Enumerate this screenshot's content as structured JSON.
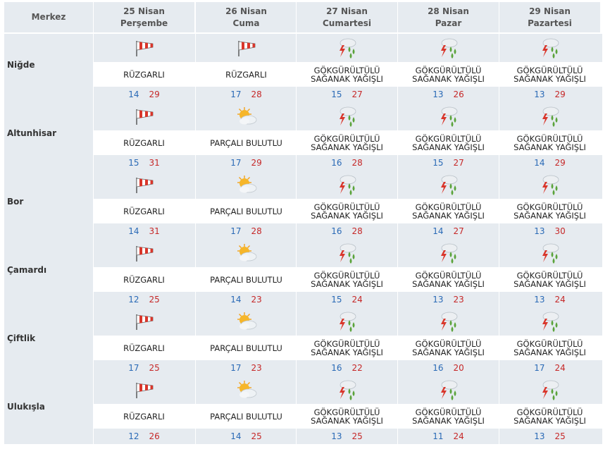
{
  "header": {
    "merkez_label": "Merkez",
    "days": [
      {
        "date": "25 Nisan",
        "weekday": "Perşembe"
      },
      {
        "date": "26 Nisan",
        "weekday": "Cuma"
      },
      {
        "date": "27 Nisan",
        "weekday": "Cumartesi"
      },
      {
        "date": "28 Nisan",
        "weekday": "Pazar"
      },
      {
        "date": "29 Nisan",
        "weekday": "Pazartesi"
      }
    ]
  },
  "colors": {
    "min_temp": "#2a6ab6",
    "max_temp": "#c62828",
    "band": "#e6ebf0"
  },
  "conditions": {
    "wind": {
      "icon": "windsock-icon",
      "l1": "RÜZGARLI",
      "l2": ""
    },
    "partly": {
      "icon": "sun-cloud-icon",
      "l1": "PARÇALI BULUTLU",
      "l2": ""
    },
    "storm": {
      "icon": "thunderstorm-icon",
      "l1": "GÖKGÜRÜLTÜLÜ",
      "l2": "SAĞANAK YAĞIŞLI"
    }
  },
  "locations": [
    {
      "name": "Niğde",
      "days": [
        {
          "c": "wind",
          "min": "14",
          "max": "29"
        },
        {
          "c": "wind",
          "min": "17",
          "max": "28"
        },
        {
          "c": "storm",
          "min": "15",
          "max": "27"
        },
        {
          "c": "storm",
          "min": "13",
          "max": "26"
        },
        {
          "c": "storm",
          "min": "13",
          "max": "29"
        }
      ]
    },
    {
      "name": "Altunhisar",
      "days": [
        {
          "c": "wind",
          "min": "15",
          "max": "31"
        },
        {
          "c": "partly",
          "min": "17",
          "max": "29"
        },
        {
          "c": "storm",
          "min": "16",
          "max": "28"
        },
        {
          "c": "storm",
          "min": "15",
          "max": "27"
        },
        {
          "c": "storm",
          "min": "14",
          "max": "29"
        }
      ]
    },
    {
      "name": "Bor",
      "days": [
        {
          "c": "wind",
          "min": "14",
          "max": "31"
        },
        {
          "c": "partly",
          "min": "17",
          "max": "28"
        },
        {
          "c": "storm",
          "min": "16",
          "max": "28"
        },
        {
          "c": "storm",
          "min": "14",
          "max": "27"
        },
        {
          "c": "storm",
          "min": "13",
          "max": "30"
        }
      ]
    },
    {
      "name": "Çamardı",
      "days": [
        {
          "c": "wind",
          "min": "12",
          "max": "25"
        },
        {
          "c": "partly",
          "min": "14",
          "max": "23"
        },
        {
          "c": "storm",
          "min": "15",
          "max": "24"
        },
        {
          "c": "storm",
          "min": "13",
          "max": "23"
        },
        {
          "c": "storm",
          "min": "13",
          "max": "24"
        }
      ]
    },
    {
      "name": "Çiftlik",
      "days": [
        {
          "c": "wind",
          "min": "17",
          "max": "25"
        },
        {
          "c": "partly",
          "min": "17",
          "max": "23"
        },
        {
          "c": "storm",
          "min": "16",
          "max": "22"
        },
        {
          "c": "storm",
          "min": "16",
          "max": "20"
        },
        {
          "c": "storm",
          "min": "17",
          "max": "24"
        }
      ]
    },
    {
      "name": "Ulukışla",
      "days": [
        {
          "c": "wind",
          "min": "12",
          "max": "26"
        },
        {
          "c": "partly",
          "min": "14",
          "max": "25"
        },
        {
          "c": "storm",
          "min": "13",
          "max": "25"
        },
        {
          "c": "storm",
          "min": "11",
          "max": "24"
        },
        {
          "c": "storm",
          "min": "13",
          "max": "25"
        }
      ]
    }
  ]
}
